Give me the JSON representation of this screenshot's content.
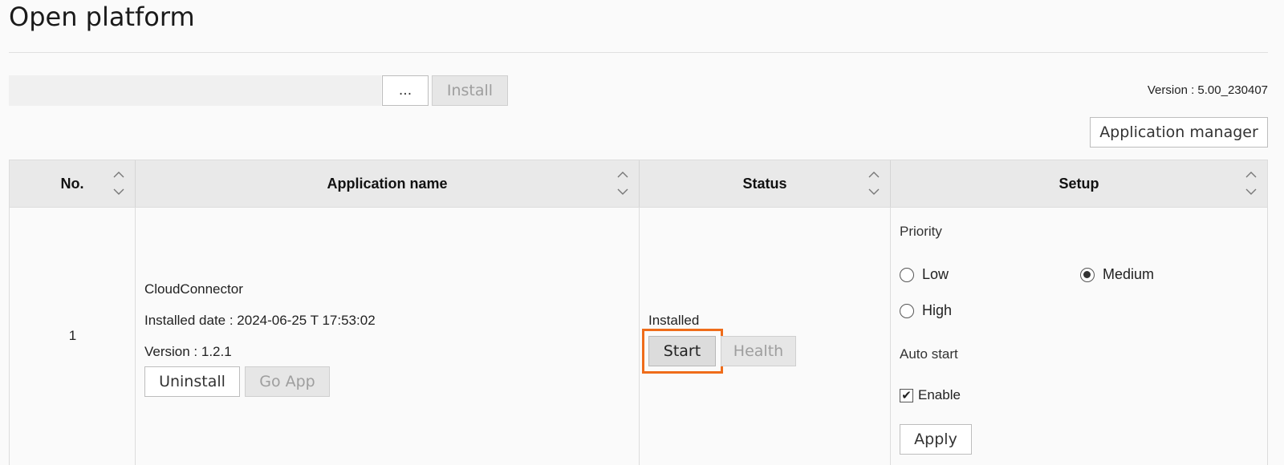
{
  "page": {
    "title": "Open platform"
  },
  "install_bar": {
    "file_path_value": "",
    "browse_label": "...",
    "install_label": "Install",
    "version_text": "Version : 5.00_230407"
  },
  "toolbar": {
    "app_manager_label": "Application manager"
  },
  "table": {
    "columns": [
      "No.",
      "Application name",
      "Status",
      "Setup"
    ],
    "rows": [
      {
        "no": "1",
        "app_name": "CloudConnector",
        "installed_date": "Installed date : 2024-06-25 T 17:53:02",
        "version": "Version : 1.2.1",
        "uninstall_label": "Uninstall",
        "goapp_label": "Go App",
        "status": "Installed",
        "start_label": "Start",
        "health_label": "Health",
        "priority_label": "Priority",
        "priority_options": [
          "Low",
          "Medium",
          "High"
        ],
        "priority_selected": "Medium",
        "auto_start_label": "Auto start",
        "enable_label": "Enable",
        "enable_checked": true,
        "apply_label": "Apply"
      }
    ]
  },
  "colors": {
    "highlight": "#ef6c1a",
    "header_bg": "#e9e9e9",
    "disabled_bg": "#e6e6e6"
  }
}
